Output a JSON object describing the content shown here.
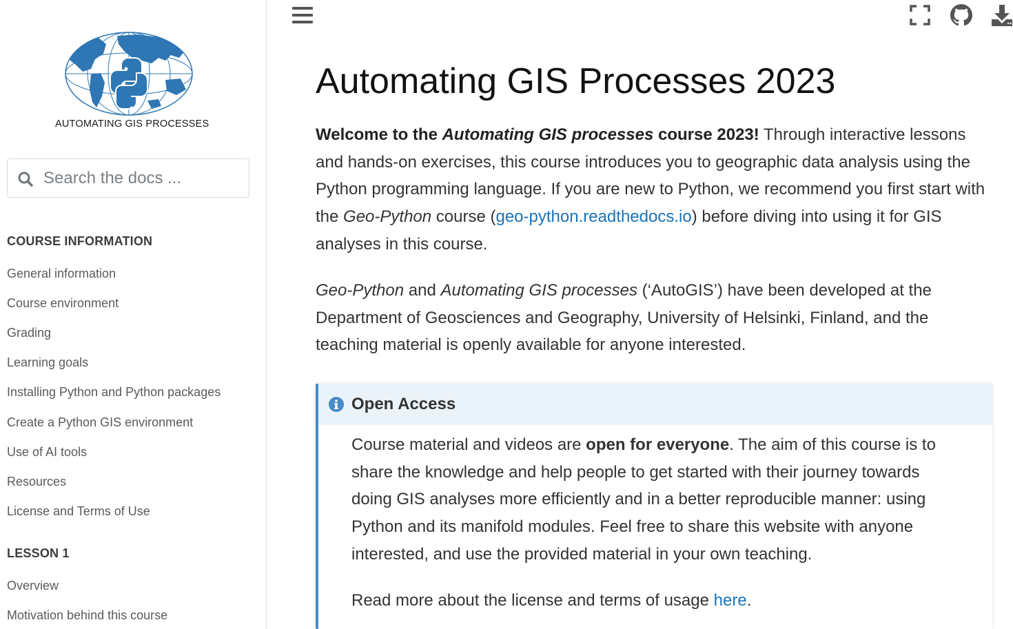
{
  "sidebar": {
    "logo_caption": "AUTOMATING GIS PROCESSES",
    "search_placeholder": "Search the docs ...",
    "sections": [
      {
        "caption": "COURSE INFORMATION",
        "items": [
          "General information",
          "Course environment",
          "Grading",
          "Learning goals",
          "Installing Python and Python packages",
          "Create a Python GIS environment",
          "Use of AI tools",
          "Resources",
          "License and Terms of Use"
        ]
      },
      {
        "caption": "LESSON 1",
        "items": [
          "Overview",
          "Motivation behind this course"
        ]
      }
    ]
  },
  "topbar": {
    "icons": [
      "menu-icon",
      "fullscreen-icon",
      "github-icon",
      "download-icon"
    ]
  },
  "main": {
    "title": "Automating GIS Processes 2023",
    "intro": {
      "bold_start": "Welcome to the ",
      "bold_italic": "Automating GIS processes",
      "bold_end": " course 2023!",
      "text1": " Through interactive lessons and hands-on exercises, this course introduces you to geographic data analysis using the Python programming language. If you are new to Python, we recommend you first start with the ",
      "italic1": "Geo-Python",
      "text2": " course (",
      "link": "geo-python.readthedocs.io",
      "text3": ") before diving into using it for GIS analyses in this course."
    },
    "second": {
      "italic1": "Geo-Python",
      "text1": " and ",
      "italic2": "Automating GIS processes",
      "text2": " (‘AutoGIS’) have been developed at the Department of Geosciences and Geography, University of Helsinki, Finland, and the teaching material is openly available for anyone interested."
    },
    "admonition": {
      "title": "Open Access",
      "p1_start": "Course material and videos are ",
      "p1_bold": "open for everyone",
      "p1_end": ". The aim of this course is to share the knowledge and help people to get started with their journey towards doing GIS analyses more efficiently and in a better reproducible manner: using Python and its manifold modules. Feel free to share this website with anyone interested, and use the provided material in your own teaching.",
      "p2_start": "Read more about the license and terms of usage ",
      "p2_link": "here",
      "p2_end": "."
    }
  },
  "colors": {
    "link": "#1a73b8",
    "admonition_accent": "#4a8bc9",
    "admonition_header_bg": "#eaf2fa",
    "logo_blue": "#2e77b4"
  }
}
